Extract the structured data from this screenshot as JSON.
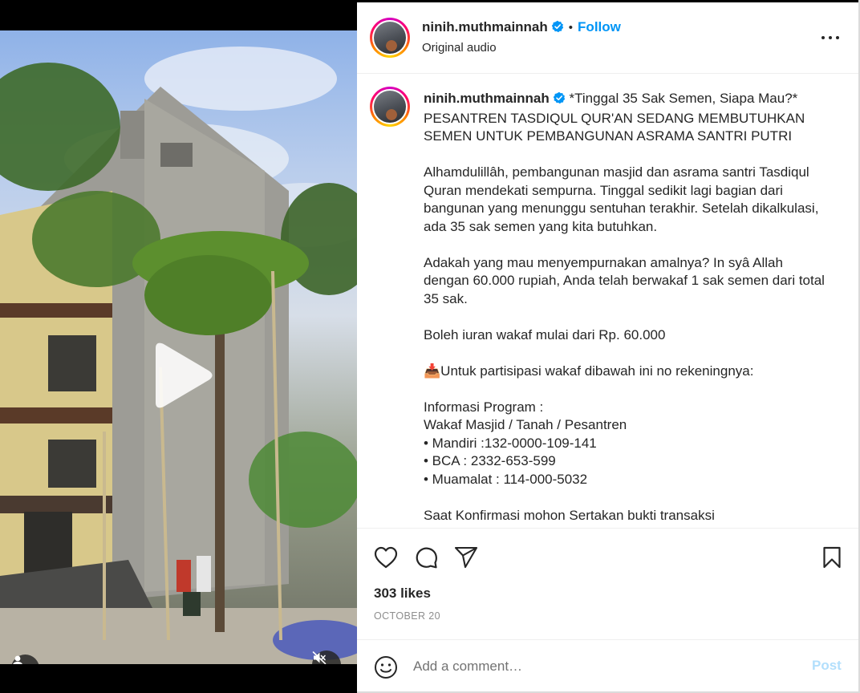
{
  "post": {
    "username": "ninih.muthmainnah",
    "follow_label": "Follow",
    "dot": "•",
    "audio": "Original audio"
  },
  "caption": {
    "username": "ninih.muthmainnah",
    "paragraphs": [
      "*Tinggal 35 Sak Semen, Siapa Mau?*\nPESANTREN TASDIQUL QUR'AN SEDANG MEMBUTUHKAN SEMEN UNTUK PEMBANGUNAN ASRAMA SANTRI PUTRI",
      "Alhamdulillâh, pembangunan masjid dan asrama santri Tasdiqul Quran mendekati sempurna. Tinggal sedikit lagi bagian dari bangunan yang menunggu sentuhan terakhir. Setelah dikalkulasi, ada 35 sak semen yang kita butuhkan.",
      "Adakah yang mau menyempurnakan amalnya? In syâ Allah dengan 60.000 rupiah, Anda telah berwakaf 1 sak semen dari total 35 sak.",
      "Boleh iuran wakaf mulai dari Rp. 60.000",
      "📥Untuk partisipasi wakaf dibawah ini no rekeningnya:",
      "Informasi Program :\nWakaf Masjid / Tanah / Pesantren\n• Mandiri :132-0000-109-141\n• BCA : 2332-653-599\n• Muamalat : 114-000-5032",
      "Saat Konfirmasi mohon Sertakan bukti transaksi"
    ]
  },
  "stats": {
    "likes": "303 likes",
    "date": "OCTOBER 20"
  },
  "comment": {
    "placeholder": "Add a comment…",
    "post_label": "Post"
  },
  "icons": {
    "more": "more-options-icon",
    "like": "heart-icon",
    "comment": "comment-icon",
    "share": "paper-plane-icon",
    "save": "bookmark-icon",
    "emoji": "emoji-icon",
    "play": "play-icon",
    "user": "user-icon",
    "mute": "speaker-muted-icon",
    "verified": "verified-badge-icon"
  },
  "colors": {
    "accent": "#0095f6",
    "post_disabled": "#b2dffc",
    "text": "#262626",
    "muted": "#8e8e8e"
  }
}
